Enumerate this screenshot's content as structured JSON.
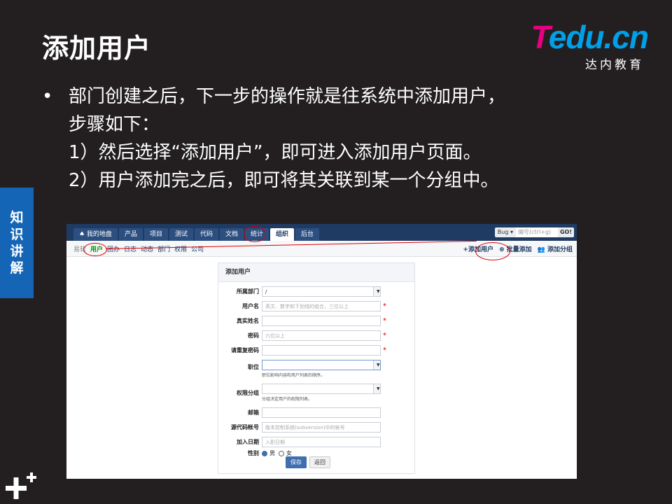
{
  "slide": {
    "title": "添加用户",
    "logo_word_t": "T",
    "logo_word_rest": "edu.cn",
    "logo_sub": "达内教育",
    "bullet_main": "部门创建之后，下一步的操作就是往系统中添加用户，",
    "bullet_main_cont": "步骤如下：",
    "step1": "1）然后选择“添加用户”，即可进入添加用户页面。",
    "step2": "2）用户添加完之后，即可将其关联到某一个分组中。",
    "side_tab": [
      "知",
      "识",
      "讲",
      "解"
    ]
  },
  "app": {
    "tabs": [
      {
        "label": "♠ 我的地盘",
        "active": false
      },
      {
        "label": "产品",
        "active": false
      },
      {
        "label": "项目",
        "active": false
      },
      {
        "label": "测试",
        "active": false
      },
      {
        "label": "代码",
        "active": false
      },
      {
        "label": "文档",
        "active": false
      },
      {
        "label": "统计",
        "active": false
      },
      {
        "label": "组织",
        "active": true
      },
      {
        "label": "后台",
        "active": false
      }
    ],
    "search": {
      "type": "Bug ▾",
      "placeholder": "编号(ctrl+g)",
      "go": "GO!"
    },
    "subnav": {
      "crumb": "易软",
      "items": [
        {
          "label": "用户",
          "active": true
        },
        {
          "label": "团办",
          "active": false
        },
        {
          "label": "日志",
          "active": false
        },
        {
          "label": "动态",
          "active": false
        },
        {
          "label": "部门",
          "active": false
        },
        {
          "label": "权限",
          "active": false
        },
        {
          "label": "公司",
          "active": false
        }
      ],
      "add_user": "+添加用户",
      "batch_add": "⊕ 批量添加",
      "add_group": "👥 添加分组"
    },
    "form": {
      "title": "添加用户",
      "dept_label": "所属部门",
      "dept_value": "/",
      "username_label": "用户名",
      "username_placeholder": "英文、数字和下划线的组合，三位以上",
      "realname_label": "真实姓名",
      "password_label": "密码",
      "password_placeholder": "六位以上",
      "repassword_label": "请重复密码",
      "role_label": "职位",
      "role_help": "职位影响内容和用户列表的顺序。",
      "group_label": "权限分组",
      "group_help": "分组决定用户的权限列表。",
      "email_label": "邮箱",
      "commiter_label": "源代码帐号",
      "commiter_placeholder": "版本控制系统(subversion)中的帐号",
      "join_label": "加入日期",
      "join_placeholder": "入职日期",
      "gender_label": "性别",
      "male": "男",
      "female": "女",
      "save": "保存",
      "back": "返回"
    }
  }
}
